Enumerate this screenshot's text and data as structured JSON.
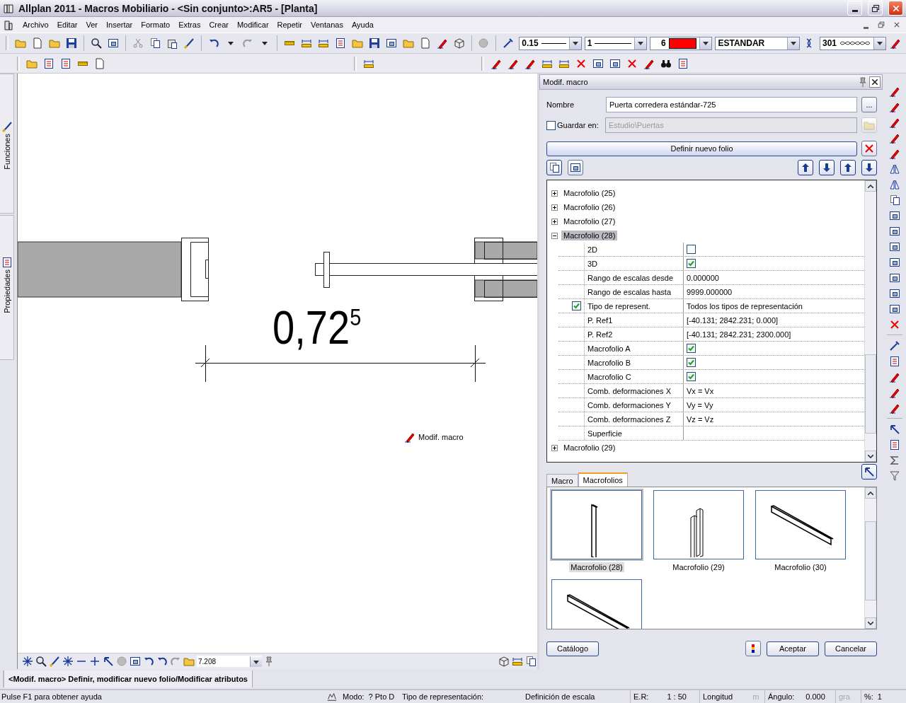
{
  "window": {
    "title": "Allplan 2011 - Macros Mobiliario - <Sin conjunto>:AR5 - [Planta]"
  },
  "menu": [
    "Archivo",
    "Editar",
    "Ver",
    "Insertar",
    "Formato",
    "Extras",
    "Crear",
    "Modificar",
    "Repetir",
    "Ventanas",
    "Ayuda"
  ],
  "toolbar": {
    "pen": "0.15",
    "line": "1",
    "color_number": "6",
    "color": "#ff0000",
    "layer": "ESTANDAR",
    "hatch": "301"
  },
  "side_tabs": [
    "Funciones",
    "Propiedades"
  ],
  "canvas": {
    "dimension": "0,72$^{5}$",
    "cursor_label": "Modif. macro",
    "zoom": "7.208"
  },
  "panel": {
    "title": "Modif. macro",
    "name_label": "Nombre",
    "name_value": "Puerta corredera estándar-725",
    "browse": "...",
    "save": {
      "label": "Guardar en:",
      "checked": false,
      "value": "Estudio\\Puertas",
      "disabled": true
    },
    "define_button": "Definir nuevo folio",
    "tree": [
      {
        "label": "Macrofolio (25)",
        "expanded": false,
        "selected": false
      },
      {
        "label": "Macrofolio (26)",
        "expanded": false,
        "selected": false
      },
      {
        "label": "Macrofolio (27)",
        "expanded": false,
        "selected": false
      },
      {
        "label": "Macrofolio (28)",
        "expanded": true,
        "selected": true,
        "properties": [
          {
            "label": "2D",
            "kind": "checkbox",
            "checked": false
          },
          {
            "label": "3D",
            "kind": "checkbox",
            "checked": true
          },
          {
            "label": "Rango de escalas desde",
            "kind": "text",
            "value": "0.000000"
          },
          {
            "label": "Rango de escalas hasta",
            "kind": "text",
            "value": "9999.000000"
          },
          {
            "label": "Tipo de represent.",
            "kind": "flagged",
            "checked": true,
            "value": "Todos los tipos de representación"
          },
          {
            "label": "P. Ref1",
            "kind": "text",
            "value": "[-40.131; 2842.231; 0.000]"
          },
          {
            "label": "P. Ref2",
            "kind": "text",
            "value": "[-40.131; 2842.231; 2300.000]"
          },
          {
            "label": "Macrofolio A",
            "kind": "checkbox",
            "checked": true
          },
          {
            "label": "Macrofolio B",
            "kind": "checkbox",
            "checked": true
          },
          {
            "label": "Macrofolio C",
            "kind": "checkbox",
            "checked": true
          },
          {
            "label": "Comb. deformaciones X",
            "kind": "text",
            "value": "Vx = Vx"
          },
          {
            "label": "Comb. deformaciones Y",
            "kind": "text",
            "value": "Vy = Vy"
          },
          {
            "label": "Comb. deformaciones Z",
            "kind": "text",
            "value": "Vz = Vz"
          },
          {
            "label": "Superficie",
            "kind": "text"
          }
        ]
      },
      {
        "label": "Macrofolio (29)",
        "expanded": false,
        "selected": false
      }
    ],
    "tabs": [
      {
        "label": "Macro",
        "selected": false
      },
      {
        "label": "Macrofolios",
        "selected": true
      }
    ],
    "thumbnails": [
      {
        "label": "Macrofolio (28)",
        "kind": "panel",
        "selected": true
      },
      {
        "label": "Macrofolio (29)",
        "kind": "double",
        "selected": false
      },
      {
        "label": "Macrofolio (30)",
        "kind": "beam",
        "selected": false
      },
      {
        "kind": "beam",
        "selected": false
      }
    ],
    "buttons": {
      "catalog": "Catálogo",
      "accept": "Aceptar",
      "cancel": "Cancelar"
    }
  },
  "command_line": "<Modif. macro> Definir, modificar nuevo folio/Modificar atributos",
  "status_bar": [
    {
      "label": "Pulse F1 para obtener ayuda",
      "dimmed": false
    },
    {
      "label": "Modo:",
      "value": "? Pto D",
      "dimmed": false
    },
    {
      "label": "Tipo de representación:",
      "dimmed": false
    },
    {
      "label": "Definición de escala",
      "dimmed": false
    },
    {
      "label": "E.R:",
      "value": "1 : 50",
      "dimmed": false
    },
    {
      "label": "Longitud",
      "value": "m",
      "dimmed": true
    },
    {
      "label": "Ángulo:",
      "value": "0.000",
      "dimmed": false
    },
    {
      "label": "gra",
      "dimmed": true
    },
    {
      "label": "%:",
      "value": "1",
      "dimmed": false
    }
  ]
}
